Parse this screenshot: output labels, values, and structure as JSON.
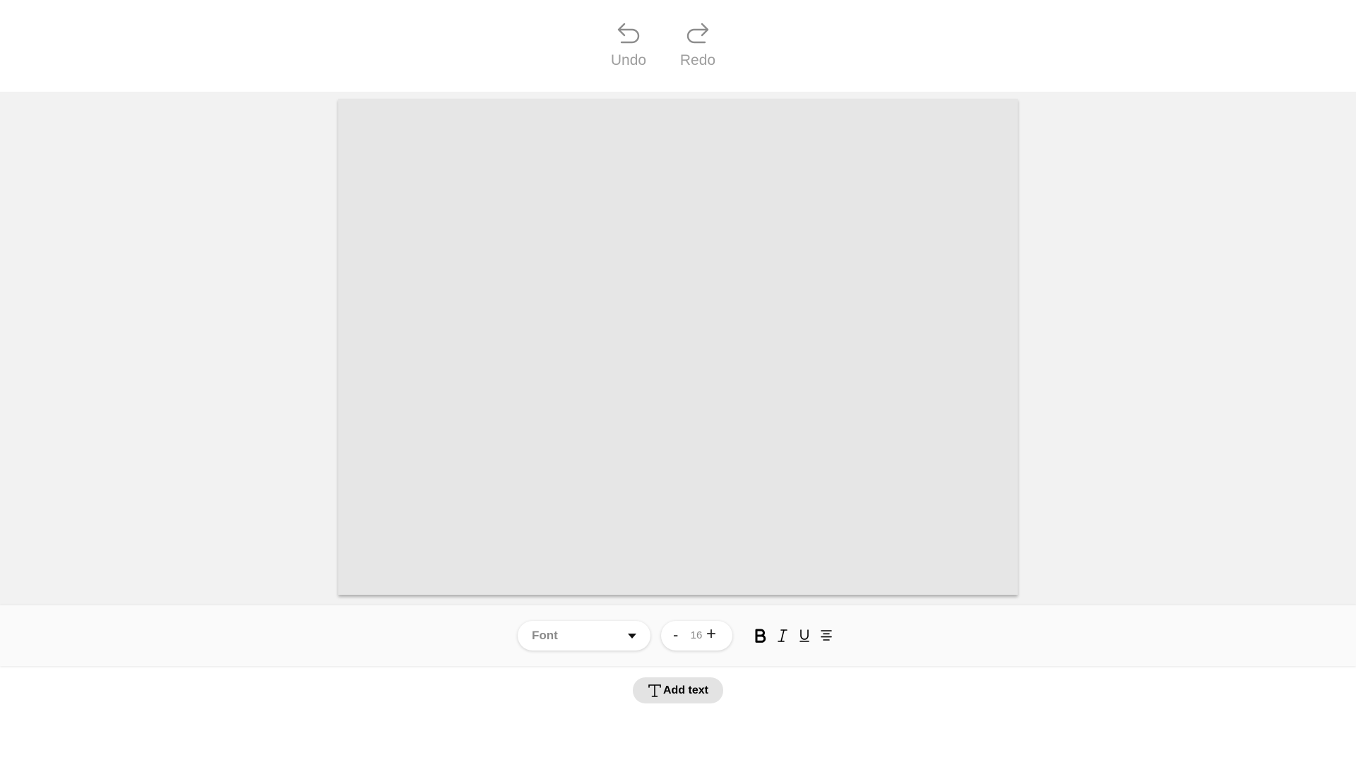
{
  "history": {
    "undo_label": "Undo",
    "redo_label": "Redo",
    "undo_icon": "undo-arrow-icon",
    "redo_icon": "redo-arrow-icon"
  },
  "format_bar": {
    "font_select": {
      "value": "Font",
      "icon": "caret-down-icon"
    },
    "font_size": {
      "minus": "-",
      "value": "16",
      "plus": "+"
    },
    "style_buttons": [
      {
        "name": "bold",
        "icon": "bold-icon"
      },
      {
        "name": "italic",
        "icon": "italic-icon"
      },
      {
        "name": "underline",
        "icon": "underline-icon"
      },
      {
        "name": "align",
        "icon": "align-center-icon"
      }
    ]
  },
  "add_text": {
    "label": "Add text",
    "icon": "text-t-icon"
  },
  "colors": {
    "workspace_bg": "#f2f2f2",
    "canvas_bg": "#e6e6e6",
    "muted_text": "#9e9e9e",
    "button_bg": "#e3e3e3"
  }
}
